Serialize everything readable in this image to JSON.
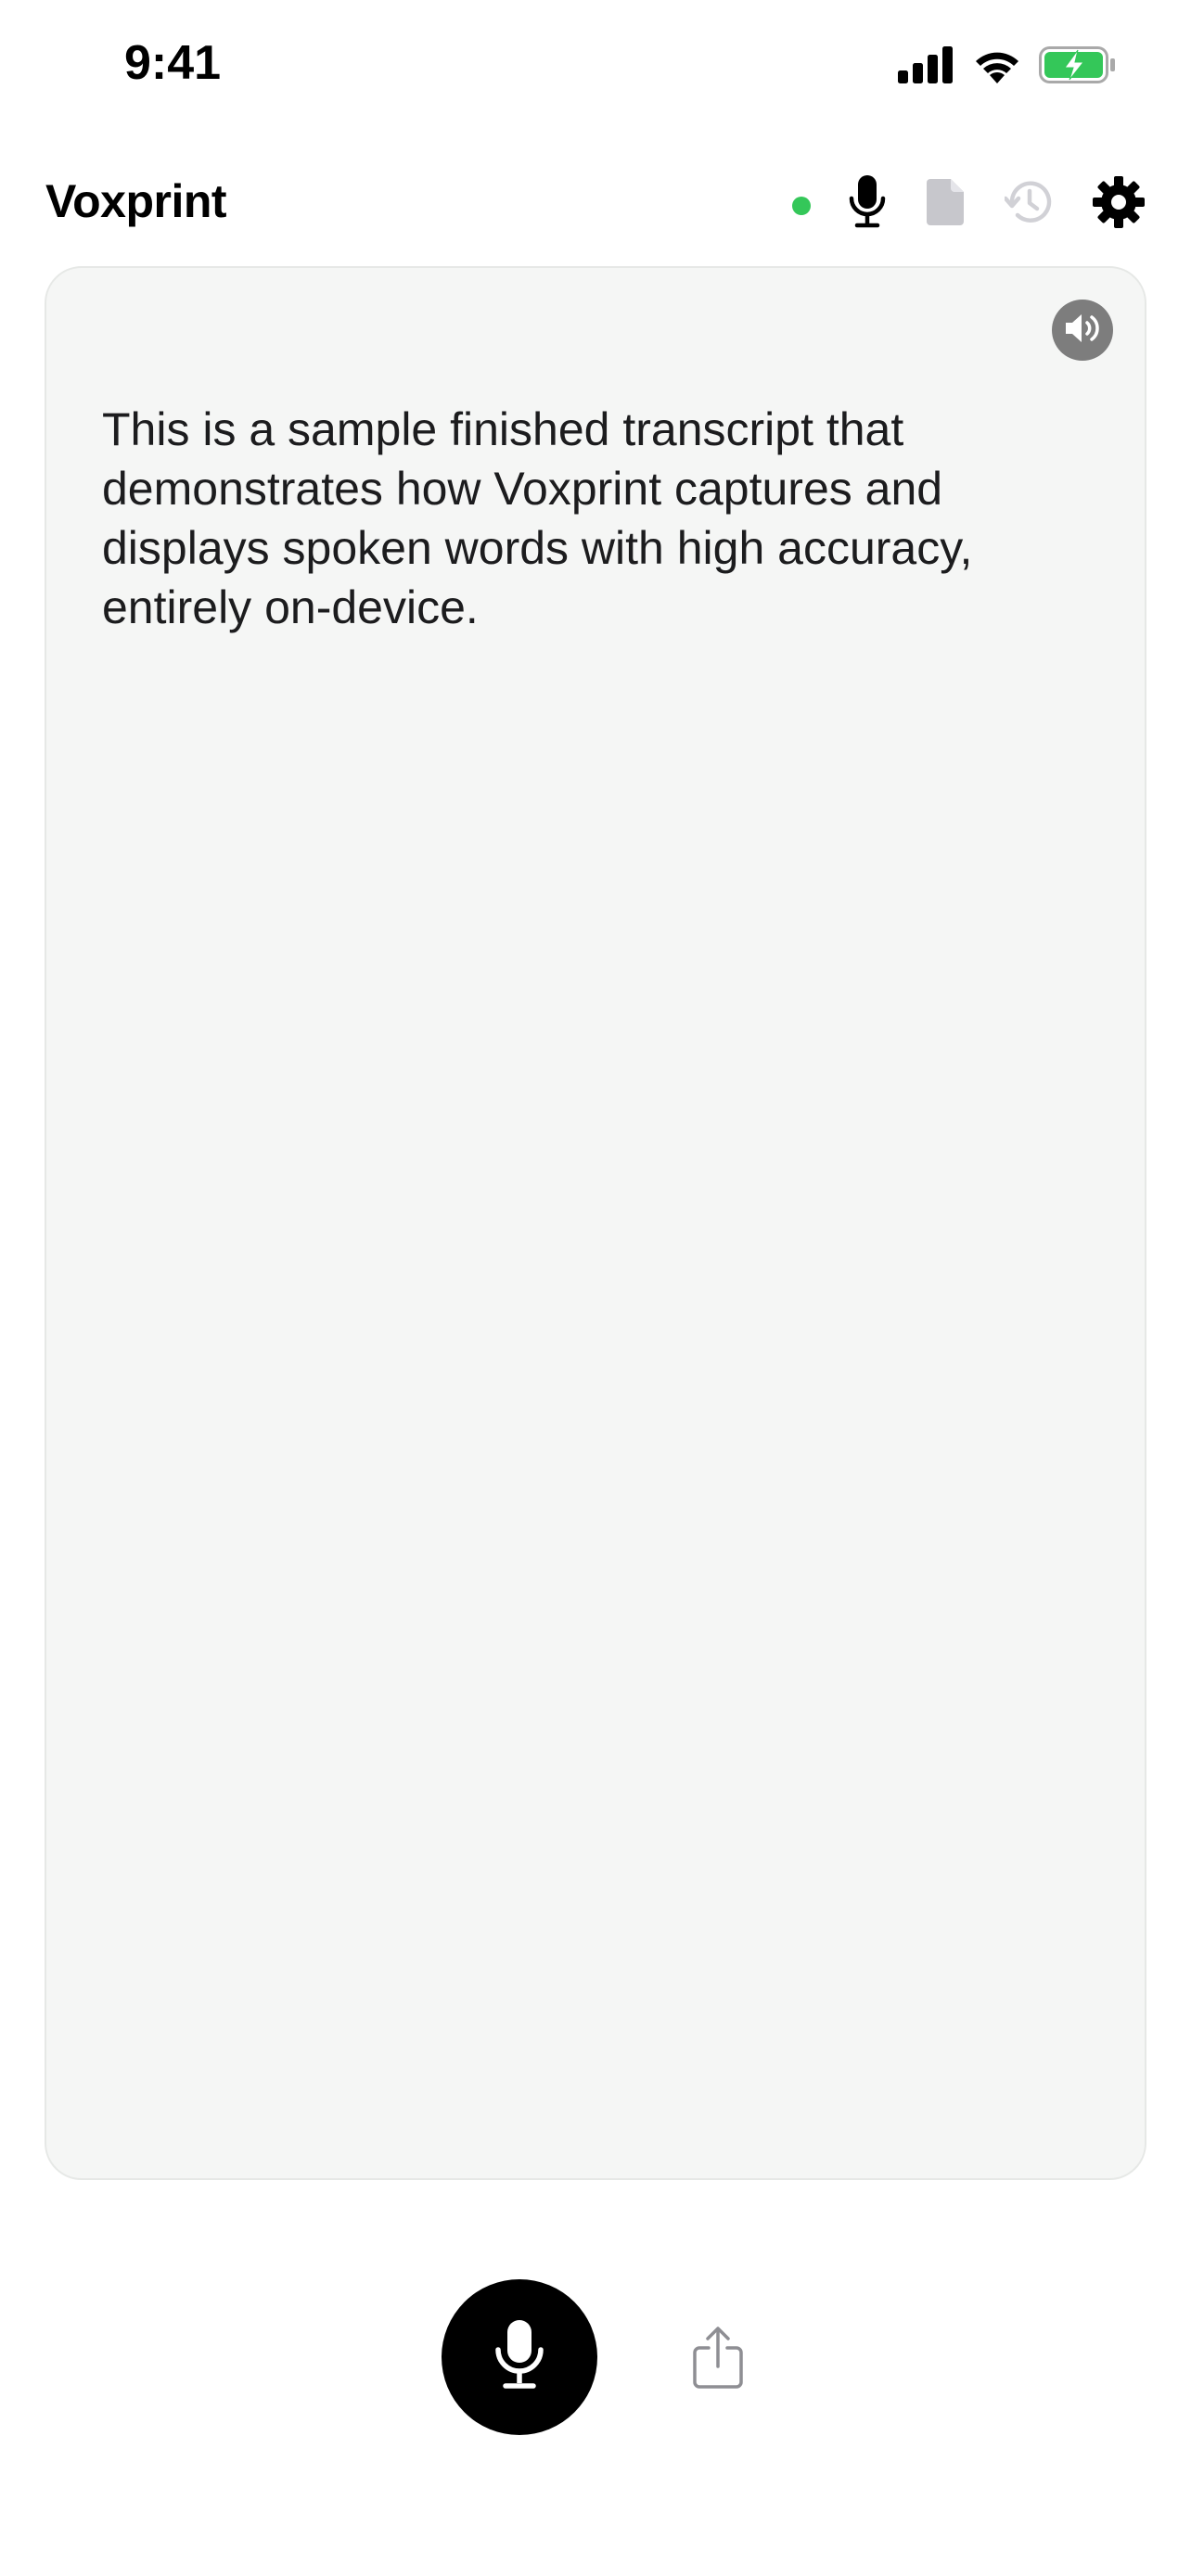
{
  "status_bar": {
    "time": "9:41",
    "icons": [
      "signal-icon",
      "wifi-icon",
      "battery-charging-icon"
    ]
  },
  "header": {
    "title": "Voxprint",
    "status_dot_color": "#34c759",
    "actions": [
      "microphone-icon",
      "document-icon",
      "history-icon",
      "gear-icon"
    ]
  },
  "transcript": {
    "text": "This is a sample finished transcript that demonstrates how Voxprint captures and displays spoken words with high accuracy, entirely on-device.",
    "speaker_icon": "speaker-icon"
  },
  "controls": {
    "record_icon": "microphone-icon",
    "share_icon": "share-icon"
  },
  "colors": {
    "accent_green": "#34c759",
    "card_background": "#f5f6f5",
    "disabled_icon": "#c7c7cc"
  }
}
